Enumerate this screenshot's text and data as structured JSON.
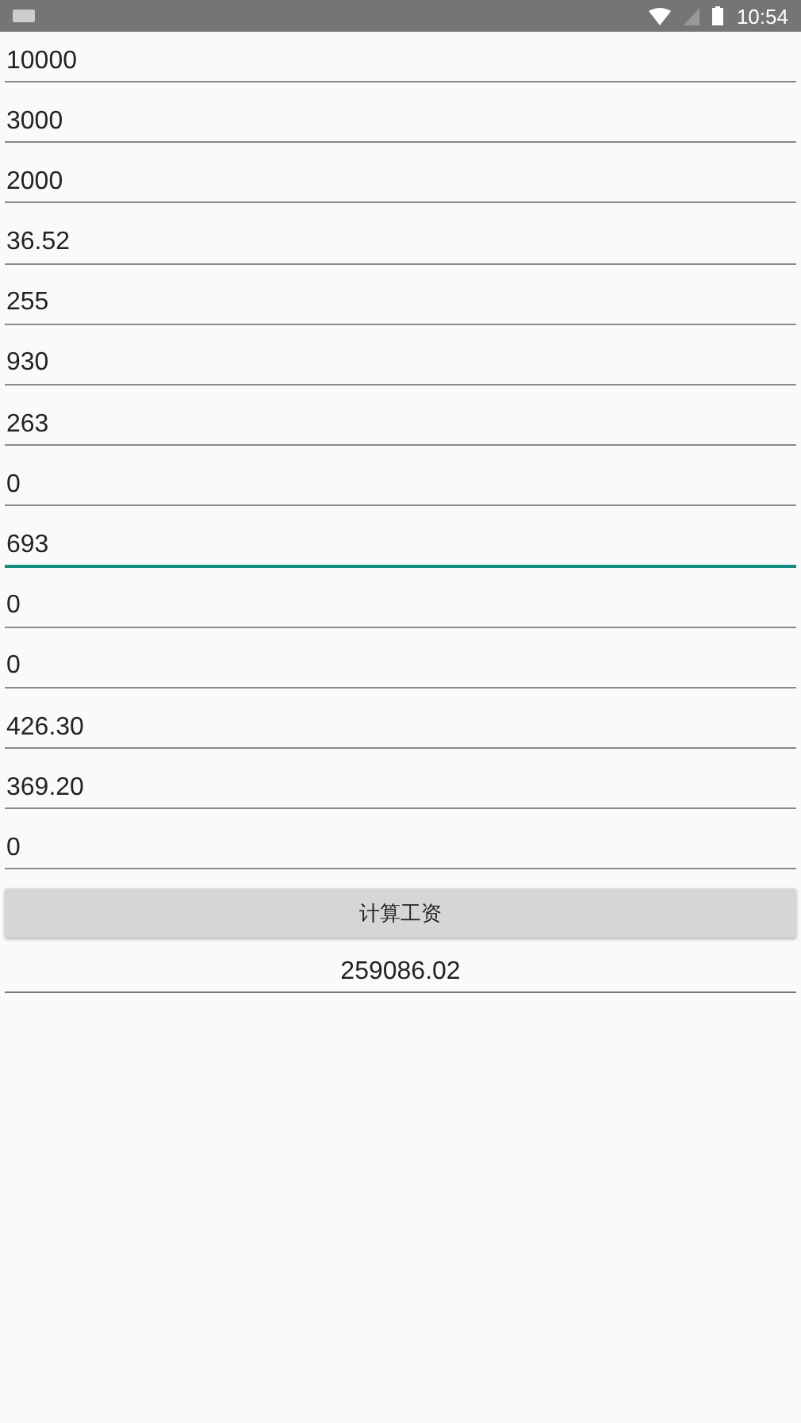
{
  "status_bar": {
    "time": "10:54"
  },
  "fields": [
    {
      "value": "10000",
      "focused": false
    },
    {
      "value": "3000",
      "focused": false
    },
    {
      "value": "2000",
      "focused": false
    },
    {
      "value": "36.52",
      "focused": false
    },
    {
      "value": "255",
      "focused": false
    },
    {
      "value": "930",
      "focused": false
    },
    {
      "value": "263",
      "focused": false
    },
    {
      "value": "0",
      "focused": false
    },
    {
      "value": "693",
      "focused": true
    },
    {
      "value": "0",
      "focused": false
    },
    {
      "value": "0",
      "focused": false
    },
    {
      "value": "426.30",
      "focused": false
    },
    {
      "value": "369.20",
      "focused": false
    },
    {
      "value": "0",
      "focused": false
    }
  ],
  "calculate_button": {
    "label": "计算工资"
  },
  "result": {
    "value": "259086.02"
  }
}
